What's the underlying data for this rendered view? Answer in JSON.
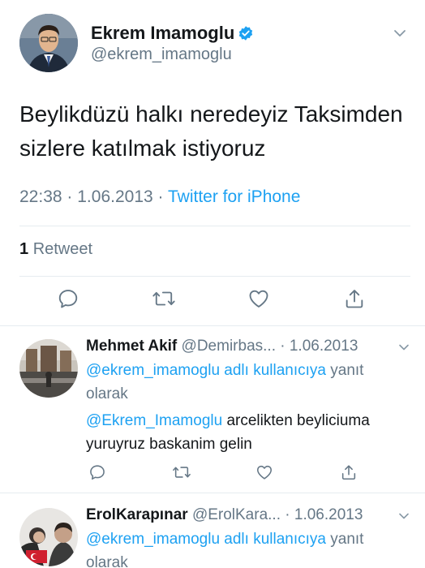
{
  "tweet": {
    "author": {
      "name": "Ekrem Imamoglu",
      "handle": "@ekrem_imamoglu",
      "verified": true,
      "avatar_icon": "profile-photo"
    },
    "text_line1": "Beylikdüzü halkı neredeyiz Taksimden",
    "text_line2": "sizlere katılmak istiyoruz",
    "time": "22:38",
    "separator": "·",
    "date": "1.06.2013",
    "source": "Twitter for iPhone",
    "retweet_count": "1",
    "retweet_label": "Retweet",
    "actions": [
      "reply-icon",
      "retweet-icon",
      "like-icon",
      "share-icon"
    ]
  },
  "replies": [
    {
      "name": "Mehmet Akif",
      "handle": "@Demirbas...",
      "separator": "·",
      "date": "1.06.2013",
      "context_mention": "@ekrem_imamoglu adlı kullanıcıya",
      "context_suffix": " yanıt",
      "context_line2": "olarak",
      "text_mention": "@Ekrem_Imamoglu",
      "text_line1_rest": " arcelikten beyliciuma",
      "text_line2": "yuruyruz baskanim gelin"
    },
    {
      "name": "ErolKarapınar",
      "handle": "@ErolKara...",
      "separator": "·",
      "date": "1.06.2013",
      "context_mention": "@ekrem_imamoglu adlı kullanıcıya",
      "context_suffix": " yanıt",
      "context_line2": "olarak"
    }
  ],
  "colors": {
    "accent": "#1da1f2",
    "secondary_text": "#657786",
    "primary_text": "#14171a",
    "divider": "#e6ecf0"
  }
}
